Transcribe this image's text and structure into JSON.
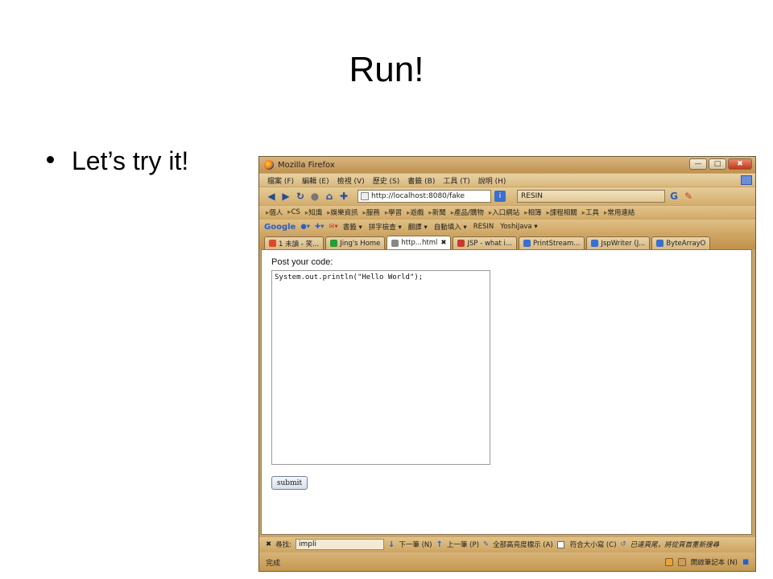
{
  "slide": {
    "title": "Run!",
    "bullet": "Let’s try it!"
  },
  "window": {
    "title": "Mozilla Firefox",
    "buttons": {
      "minimize": "—",
      "maximize": "□",
      "close": "✖"
    }
  },
  "menu": [
    "檔案 (F)",
    "編輯 (E)",
    "檢視 (V)",
    "歷史 (S)",
    "書籤 (B)",
    "工具 (T)",
    "說明 (H)"
  ],
  "nav": {
    "url": "http://localhost:8080/fake",
    "search_engine_value": "RESIN"
  },
  "bookmarks": [
    "個人",
    "CS",
    "知識",
    "娛樂資訊",
    "服務",
    "學習",
    "遊戲",
    "新聞",
    "產品/購物",
    "入口網站",
    "相簿",
    "課程相關",
    "工具",
    "常用連結"
  ],
  "google_bar": {
    "logo": "Google",
    "items": [
      "書籤 ▾",
      "拼字檢查 ▾",
      "翻譯 ▾",
      "自動填入 ▾",
      "RESIN",
      "YoshiJava ▾"
    ]
  },
  "tabs": [
    {
      "label": "1 未讀 - 笑...",
      "active": false,
      "color": "#d94a2a"
    },
    {
      "label": "Jing's Home",
      "active": false,
      "color": "#22a032"
    },
    {
      "label": "http...html",
      "active": true,
      "color": "#888888"
    },
    {
      "label": "JSP - what i...",
      "active": false,
      "color": "#c83a2a"
    },
    {
      "label": "PrintStream...",
      "active": false,
      "color": "#3a6fd0"
    },
    {
      "label": "JspWriter (J...",
      "active": false,
      "color": "#3a6fd0"
    },
    {
      "label": "ByteArrayO",
      "active": false,
      "color": "#3a6fd0"
    }
  ],
  "page": {
    "label": "Post your code:",
    "code": "System.out.println(\"Hello World\");",
    "submit_label": "submit"
  },
  "findbar": {
    "label": "尋找:",
    "value": "impli",
    "next": "下一筆 (N)",
    "prev": "上一筆 (P)",
    "highlight": "全部高亮度標示 (A)",
    "match_case": "符合大小寫 (C)",
    "wrap_message": "已達頁尾，將從頁首重新搜尋"
  },
  "status": {
    "text": "完成",
    "right": "開啟筆記本 (N)"
  }
}
